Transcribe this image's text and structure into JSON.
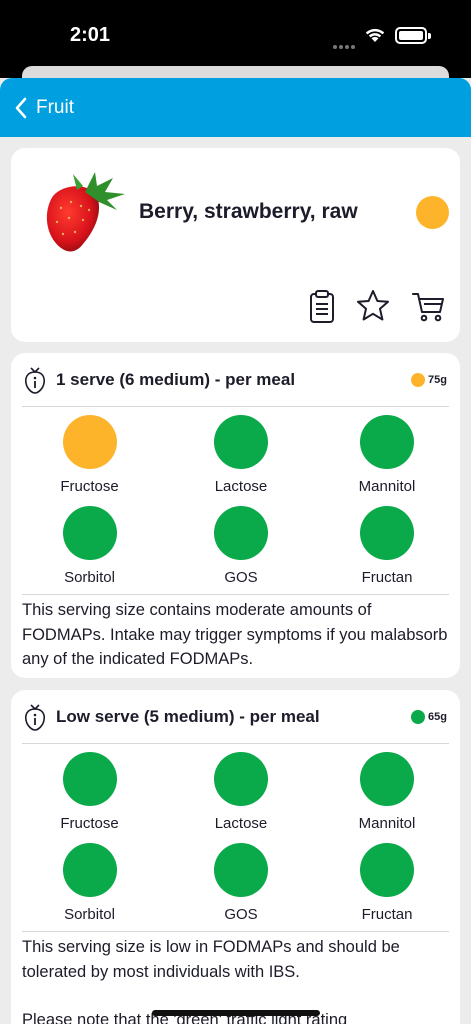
{
  "status": {
    "time": "2:01"
  },
  "nav": {
    "back_label": "Fruit"
  },
  "food": {
    "name": "Berry, strawberry, raw",
    "rating_color": "#fdb42b"
  },
  "colors": {
    "amber": "#fdb42b",
    "green": "#0aa94a",
    "brand": "#009fdf"
  },
  "serves": [
    {
      "title": "1 serve (6 medium) - per meal",
      "weight": "75g",
      "dot": "#fdb42b",
      "items": [
        {
          "label": "Fructose",
          "color": "#fdb42b"
        },
        {
          "label": "Lactose",
          "color": "#0aa94a"
        },
        {
          "label": "Mannitol",
          "color": "#0aa94a"
        },
        {
          "label": "Sorbitol",
          "color": "#0aa94a"
        },
        {
          "label": "GOS",
          "color": "#0aa94a"
        },
        {
          "label": "Fructan",
          "color": "#0aa94a"
        }
      ],
      "description": "This serving size contains moderate amounts of FODMAPs. Intake may trigger symptoms if you malabsorb any of the indicated FODMAPs."
    },
    {
      "title": "Low serve (5 medium) - per meal",
      "weight": "65g",
      "dot": "#0aa94a",
      "items": [
        {
          "label": "Fructose",
          "color": "#0aa94a"
        },
        {
          "label": "Lactose",
          "color": "#0aa94a"
        },
        {
          "label": "Mannitol",
          "color": "#0aa94a"
        },
        {
          "label": "Sorbitol",
          "color": "#0aa94a"
        },
        {
          "label": "GOS",
          "color": "#0aa94a"
        },
        {
          "label": "Fructan",
          "color": "#0aa94a"
        }
      ],
      "description": "This serving size is low in FODMAPs and should be tolerated by most individuals with IBS.",
      "note": "Please note that the 'green' traffic light rating"
    }
  ]
}
